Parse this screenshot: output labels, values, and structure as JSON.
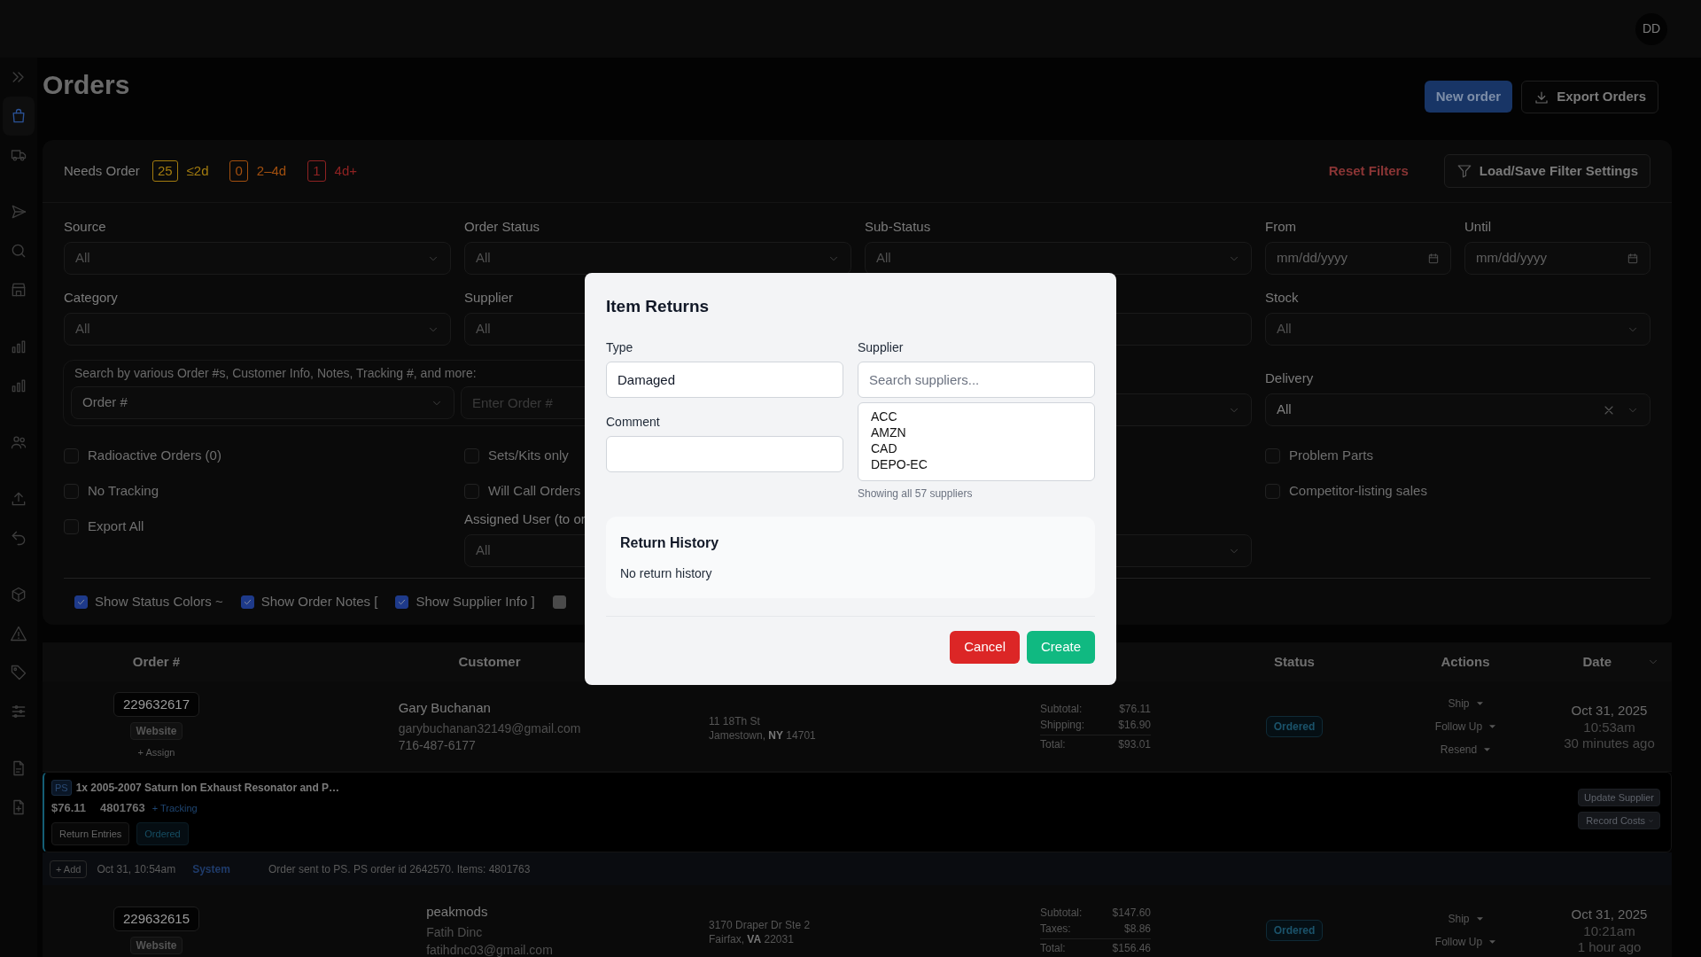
{
  "top_bar": {
    "avatar": "DD"
  },
  "sidebar": {
    "groups": [
      [
        {
          "kind": "toggle",
          "selected": false
        },
        {
          "kind": "orders",
          "selected": true
        },
        {
          "kind": "shipping",
          "selected": false
        }
      ],
      [
        {
          "kind": "send",
          "selected": false
        },
        {
          "kind": "search",
          "selected": false
        },
        {
          "kind": "store",
          "selected": false
        }
      ],
      [
        {
          "kind": "chart",
          "selected": false
        },
        {
          "kind": "chart",
          "selected": false
        }
      ],
      [
        {
          "kind": "users",
          "selected": false
        }
      ],
      [
        {
          "kind": "upload",
          "selected": false
        },
        {
          "kind": "undo",
          "selected": false
        }
      ],
      [
        {
          "kind": "cube",
          "selected": false
        },
        {
          "kind": "warning",
          "selected": false
        },
        {
          "kind": "tag",
          "selected": false
        },
        {
          "kind": "sliders",
          "selected": false
        }
      ],
      [
        {
          "kind": "document",
          "selected": false
        },
        {
          "kind": "new-document",
          "selected": false
        }
      ]
    ]
  },
  "page": {
    "title": "Orders",
    "buttons": [
      {
        "kind": "primary",
        "label": "New order"
      },
      {
        "kind": "export",
        "label": "Export Orders"
      }
    ]
  },
  "needs_order": {
    "label": "Needs Order",
    "buckets": [
      {
        "count": "25",
        "range": "≤2d",
        "color": "#a37c0f"
      },
      {
        "count": "0",
        "range": "2–4d",
        "color": "#a3500f"
      },
      {
        "count": "1",
        "range": "4d+",
        "color": "#8f2222"
      }
    ]
  },
  "reset_filters": "Reset Filters",
  "filter_settings_button": "Load/Save Filter Settings",
  "filter_rows": [
    [
      {
        "kind": "select",
        "label": "Source",
        "placeholder": "All"
      },
      {
        "kind": "select",
        "label": "Order Status",
        "placeholder": "All"
      },
      {
        "kind": "select",
        "label": "Sub-Status",
        "placeholder": "All"
      },
      {
        "kind": "date",
        "label": "From",
        "placeholder": "mm/dd/yyyy"
      },
      {
        "kind": "date",
        "label": "Until",
        "placeholder": "mm/dd/yyyy"
      }
    ],
    [
      {
        "kind": "select",
        "label": "Category",
        "placeholder": "All"
      },
      {
        "kind": "input",
        "label": "Supplier",
        "placeholder": "All"
      },
      {
        "kind": "input"
      },
      {
        "kind": "select",
        "label": "Stock",
        "placeholder": "All"
      }
    ],
    [
      {
        "kind": "search",
        "label": "Search by various Order #s, Customer Info, Notes, Tracking #, and more:",
        "value": "Order #",
        "placeholder": "Enter Order #"
      },
      {
        "kind": "select"
      },
      {
        "kind": "select",
        "label": "Delivery",
        "value": "All",
        "clearable": true
      }
    ]
  ],
  "filter_options": [
    [
      {
        "kind": "checkbox",
        "label": "Radioactive Orders (0)",
        "checked": false
      },
      {
        "kind": "checkbox",
        "label": "No Tracking",
        "checked": false
      },
      {
        "kind": "checkbox",
        "label": "Export All",
        "checked": false
      }
    ],
    [
      {
        "kind": "checkbox",
        "label": "Sets/Kits only",
        "checked": false
      },
      {
        "kind": "checkbox",
        "label": "Will Call Orders",
        "checked": false
      },
      {
        "kind": "input",
        "label": "Assigned User (to or",
        "placeholder": "All"
      }
    ],
    [
      {
        "kind": "select"
      }
    ],
    [
      {
        "kind": "checkbox",
        "label": "Problem Parts",
        "checked": false
      },
      {
        "kind": "checkbox",
        "label": "Competitor-listing sales",
        "checked": false
      }
    ]
  ],
  "display_options": [
    {
      "label": "Show Status Colors ~",
      "checked": true,
      "disabled": false
    },
    {
      "label": "Show Order Notes [",
      "checked": true,
      "disabled": false
    },
    {
      "label": "Show Supplier Info ]",
      "checked": true,
      "disabled": false
    },
    {
      "checked": false,
      "disabled": true
    }
  ],
  "table": {
    "header": {
      "order": "Order #",
      "customer": "Customer",
      "status": "Status",
      "actions": "Actions",
      "date": "Date"
    },
    "rows": [
      {
        "order_number": "229632617",
        "source": "Website",
        "assign": "+ Assign",
        "customer": [
          {
            "kind": "name",
            "text": "Gary Buchanan"
          },
          {
            "kind": "muted",
            "text": "garybuchanan32149@gmail.com"
          },
          {
            "kind": "phone",
            "text": "716-487-6177"
          }
        ],
        "address": [
          "11 18Th St",
          "Jamestown, **NY** 14701"
        ],
        "totals": [
          {
            "kind": "line",
            "label": "Subtotal:",
            "value": "$76.11"
          },
          {
            "kind": "line",
            "label": "Shipping:",
            "value": "$16.90"
          },
          {
            "kind": "total",
            "label": "Total:",
            "value": "$93.01"
          }
        ],
        "status": "Ordered",
        "actions": [
          "Ship",
          "Follow Up",
          "Resend"
        ],
        "date": [
          "Oct 31, 2025",
          "10:53am",
          "30 minutes ago"
        ],
        "items": [
          {
            "supplier_tag": "PS",
            "title": "1x 2005-2007 Saturn Ion Exhaust Resonator and P…",
            "price": "$76.11",
            "part_number": "4801763",
            "tracking_link": "+ Tracking",
            "return_button": "Return Entries",
            "status": "Ordered",
            "buttons": [
              {
                "kind": "plain",
                "label": "Update Supplier"
              },
              {
                "kind": "menu",
                "label": "Record Costs"
              }
            ]
          }
        ],
        "notes": [
          {
            "add_button": "+ Add",
            "time": "Oct 31, 10:54am",
            "author": "System",
            "text": "Order sent to PS. PS order id 2642570. Items: 4801763"
          }
        ]
      },
      {
        "order_number": "229632615",
        "source": "Website",
        "customer": [
          {
            "kind": "name",
            "text": "peakmods"
          },
          {
            "kind": "muted",
            "text": "Fatih Dinc"
          },
          {
            "kind": "muted",
            "text": "fatihdnc03@gmail.com"
          }
        ],
        "address": [
          "3170 Draper Dr Ste 2",
          "Fairfax, **VA** 22031"
        ],
        "totals": [
          {
            "kind": "line",
            "label": "Subtotal:",
            "value": "$147.60"
          },
          {
            "kind": "line",
            "label": "Taxes:",
            "value": "$8.86"
          },
          {
            "kind": "total",
            "label": "Total:",
            "value": "$156.46"
          }
        ],
        "status": "Ordered",
        "actions": [
          "Ship",
          "Follow Up"
        ],
        "date": [
          "Oct 31, 2025",
          "10:21am",
          "1 hour ago"
        ]
      }
    ]
  },
  "modal": {
    "title": "Item Returns",
    "type": {
      "label": "Type",
      "value": "Damaged"
    },
    "comment": {
      "label": "Comment"
    },
    "supplier": {
      "label": "Supplier",
      "placeholder": "Search suppliers...",
      "options": [
        "ACC",
        "AMZN",
        "CAD",
        "DEPO-EC"
      ],
      "count_note": "Showing all 57 suppliers"
    },
    "history": {
      "title": "Return History",
      "empty_text": "No return history"
    },
    "buttons": [
      {
        "kind": "cancel",
        "label": "Cancel"
      },
      {
        "kind": "create",
        "label": "Create"
      }
    ]
  }
}
